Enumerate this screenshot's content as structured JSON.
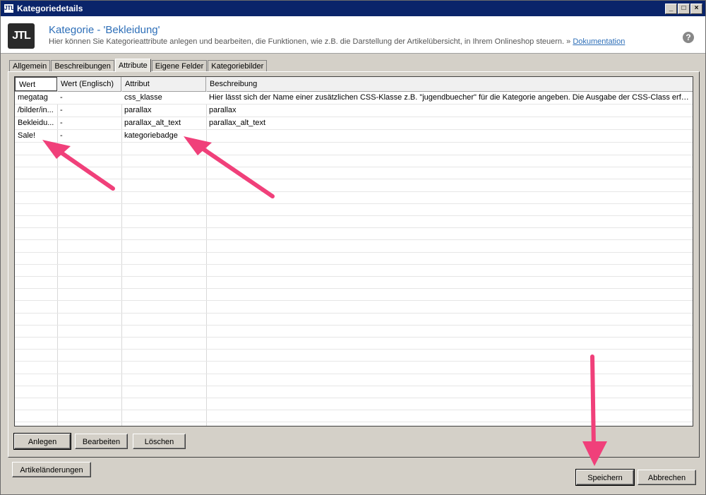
{
  "window": {
    "title": "Kategoriedetails",
    "logo_small": "JTL"
  },
  "header": {
    "logo": "JTL",
    "title": "Kategorie - 'Bekleidung'",
    "subtitle": "Hier können Sie Kategorieattribute anlegen und bearbeiten, die Funktionen, wie z.B. die Darstellung der Artikelübersicht, in Ihrem Onlineshop steuern. »",
    "doc_link": "Dokumentation",
    "help": "?"
  },
  "tabs": [
    "Allgemein",
    "Beschreibungen",
    "Attribute",
    "Eigene Felder",
    "Kategoriebilder"
  ],
  "table": {
    "headers": [
      "Wert",
      "Wert (Englisch)",
      "Attribut",
      "Beschreibung"
    ],
    "rows": [
      [
        "megatag",
        "-",
        "css_klasse",
        "Hier lässt sich der Name einer zusätzlichen CSS-Klasse z.B. \"jugendbuecher\" für die Kategorie angeben. Die Ausgabe der CSS-Class erfolgt im..."
      ],
      [
        "/bilder/in...",
        "-",
        "parallax",
        "parallax"
      ],
      [
        "Bekleidu...",
        "-",
        "parallax_alt_text",
        "parallax_alt_text"
      ],
      [
        "Sale!",
        "-",
        "kategoriebadge",
        ""
      ]
    ]
  },
  "buttons": {
    "anlegen": "Anlegen",
    "bearbeiten": "Bearbeiten",
    "loeschen": "Löschen",
    "artikelaenderungen": "Artikeländerungen",
    "speichern": "Speichern",
    "abbrechen": "Abbrechen"
  },
  "colors": {
    "titlebar": "#0a246a",
    "accent": "#2e6fb8",
    "annotation_arrow": "#f0407a"
  }
}
